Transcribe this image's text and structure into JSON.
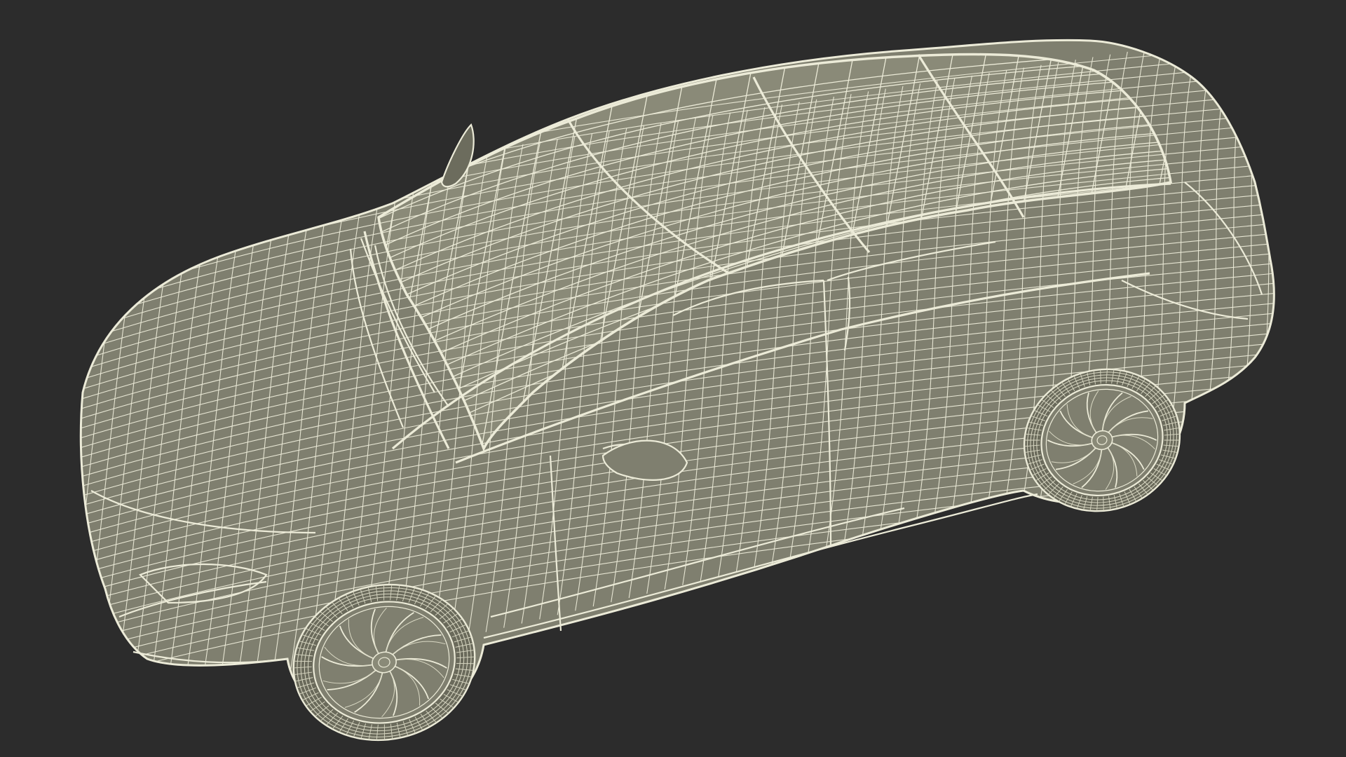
{
  "scene": {
    "subject": "car-wireframe-render",
    "colors": {
      "background": "#2c2c2c",
      "surface": "#7f7f6f",
      "surface_light": "#8a8a78",
      "surface_dark": "#6c6c5d",
      "wire": "#ecebd8",
      "wire_soft": "#d9d8c3",
      "tire": "#6a6a5b"
    }
  }
}
